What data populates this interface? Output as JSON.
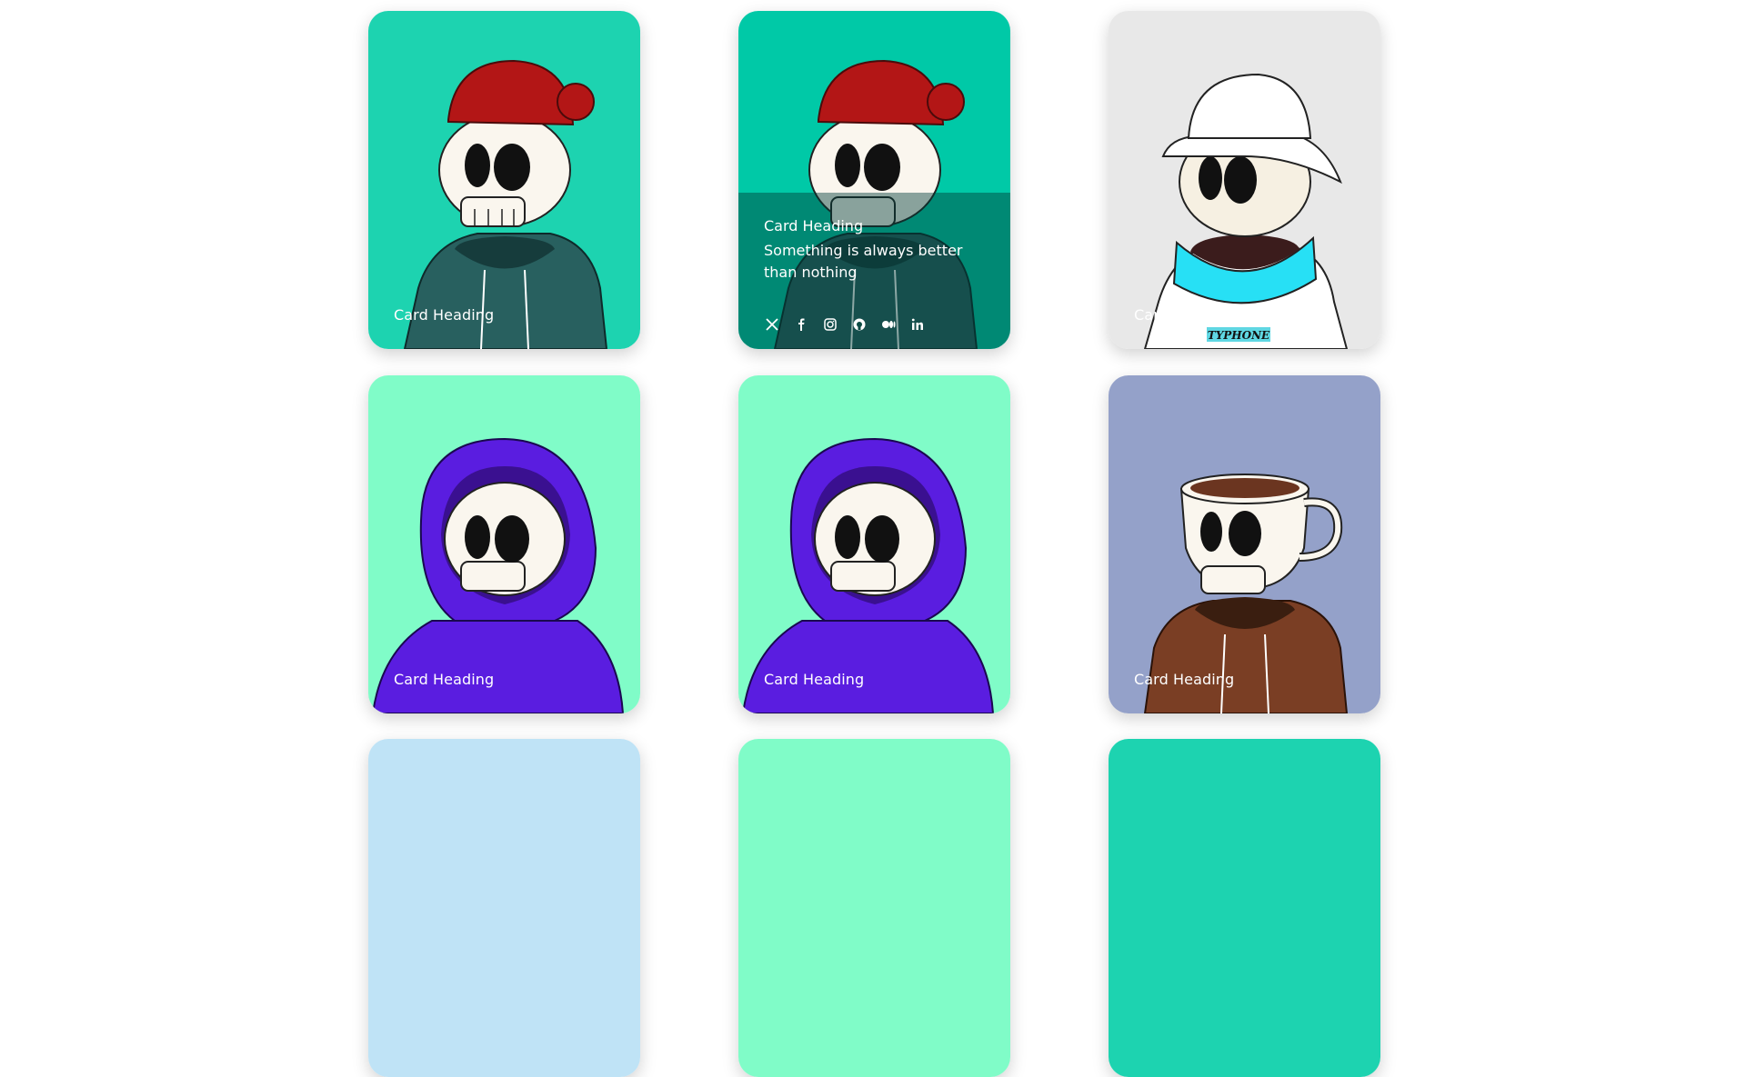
{
  "cards": [
    {
      "heading": "Card Heading",
      "bg": "#1dd3b0",
      "hat": "beanie",
      "hoodie": "#28605f"
    },
    {
      "heading": "Card Heading",
      "description": "Something is always better than nothing",
      "bg": "#00c9a7",
      "hat": "beanie",
      "hoodie": "#28605f",
      "socials": [
        "x-icon",
        "facebook-icon",
        "instagram-icon",
        "github-icon",
        "medium-icon",
        "linkedin-icon"
      ]
    },
    {
      "heading": "Card Heading",
      "bg": "#e8e8e8",
      "hat": "bucket",
      "shirt_text": "TYPHONE"
    },
    {
      "heading": "Card Heading",
      "bg": "#80fcc8",
      "hoodie": "#5a1de0"
    },
    {
      "heading": "Card Heading",
      "bg": "#80fcc8",
      "hoodie": "#5a1de0"
    },
    {
      "heading": "Card Heading",
      "bg": "#94a1c9",
      "hat": "mug",
      "hoodie": "#7a3e24"
    },
    {
      "bg": "#bfe3f6"
    },
    {
      "bg": "#80fcc8"
    },
    {
      "bg": "#1dd3b0"
    }
  ]
}
